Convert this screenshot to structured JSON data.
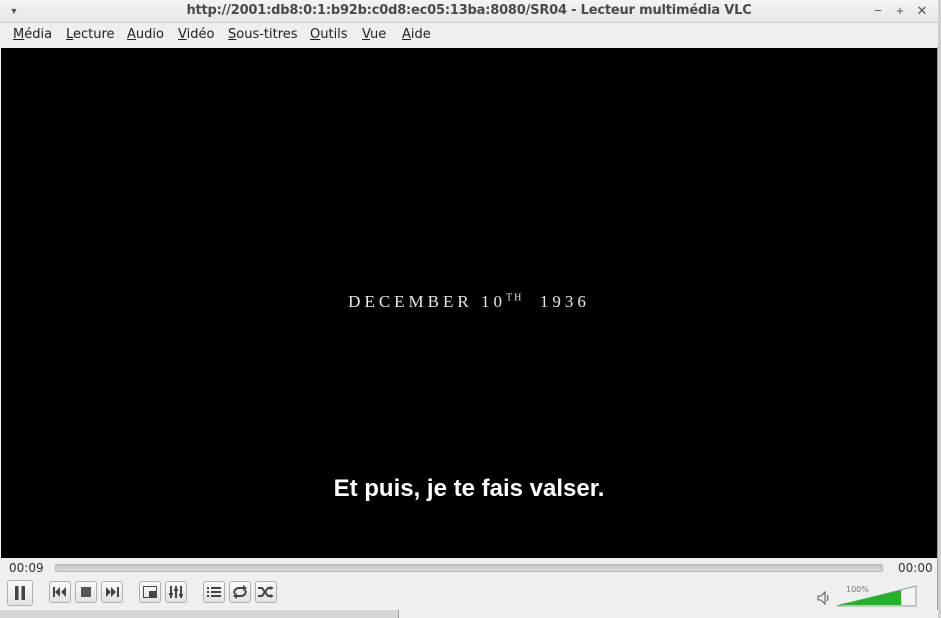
{
  "window": {
    "title": "http://2001:db8:0:1:b92b:c0d8:ec05:13ba:8080/SR04 - Lecteur multimédia VLC"
  },
  "menubar": {
    "items": [
      {
        "first": "M",
        "rest": "édia"
      },
      {
        "first": "L",
        "rest": "ecture"
      },
      {
        "first": "A",
        "rest": "udio"
      },
      {
        "first": "V",
        "rest": "idéo"
      },
      {
        "first": "S",
        "rest": "ous-titres"
      },
      {
        "first": "O",
        "rest": "utils"
      },
      {
        "first": "V",
        "rest": "ue"
      },
      {
        "first": "A",
        "rest": "ide"
      }
    ]
  },
  "video": {
    "date_text": "DECEMBER 10",
    "date_sup": "TH",
    "date_year": "1936",
    "subtitle": "Et puis, je te fais valser."
  },
  "playback": {
    "elapsed": "00:09",
    "remaining": "00:00",
    "progress": 0.0
  },
  "volume": {
    "label": "100%",
    "level": 1.0,
    "color": "#22b32a"
  },
  "icons": {
    "pause": "pause-icon",
    "previous": "previous-icon",
    "stop": "stop-icon",
    "next": "next-icon",
    "fullscreen": "fullscreen-icon",
    "extended": "equalizer-icon",
    "playlist": "playlist-icon",
    "loop": "loop-icon",
    "random": "shuffle-icon",
    "volume": "speaker-icon"
  }
}
